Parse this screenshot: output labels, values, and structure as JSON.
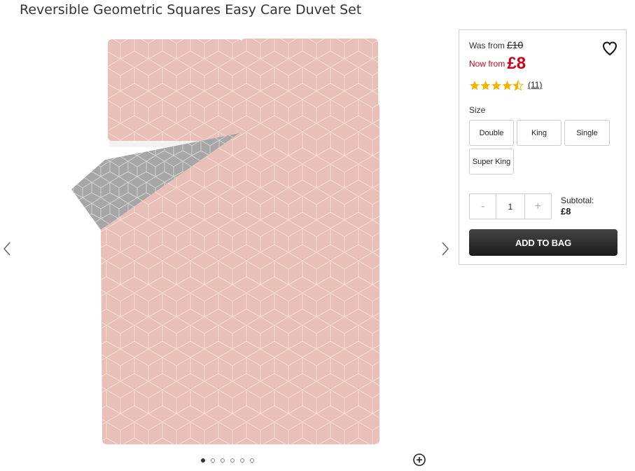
{
  "product": {
    "title": "Reversible Geometric Squares Easy Care Duvet Set"
  },
  "pricing": {
    "was_label": "Was from",
    "was_price": "£10",
    "now_label": "Now from",
    "now_price": "£8"
  },
  "rating": {
    "stars": 4.5,
    "max": 5,
    "review_count": "(11)"
  },
  "size": {
    "label": "Size",
    "options": [
      "Double",
      "King",
      "Single",
      "Super King"
    ]
  },
  "quantity": {
    "minus": "-",
    "value": "1",
    "plus": "+"
  },
  "subtotal": {
    "label": "Subtotal:",
    "amount": "£8"
  },
  "actions": {
    "add_to_bag": "ADD TO BAG"
  },
  "gallery": {
    "image_count": 6,
    "active_index": 0
  },
  "colors": {
    "price_red": "#d0021b",
    "star_gold": "#f5b301",
    "duvet_pink": "#e8c0b8",
    "duvet_grey": "#a6a6a6",
    "button_dark": "#2a2a2a"
  },
  "icons": {
    "heart": "heart-icon",
    "star": "star-icon",
    "prev": "chevron-left-icon",
    "next": "chevron-right-icon",
    "zoom": "zoom-plus-icon"
  }
}
